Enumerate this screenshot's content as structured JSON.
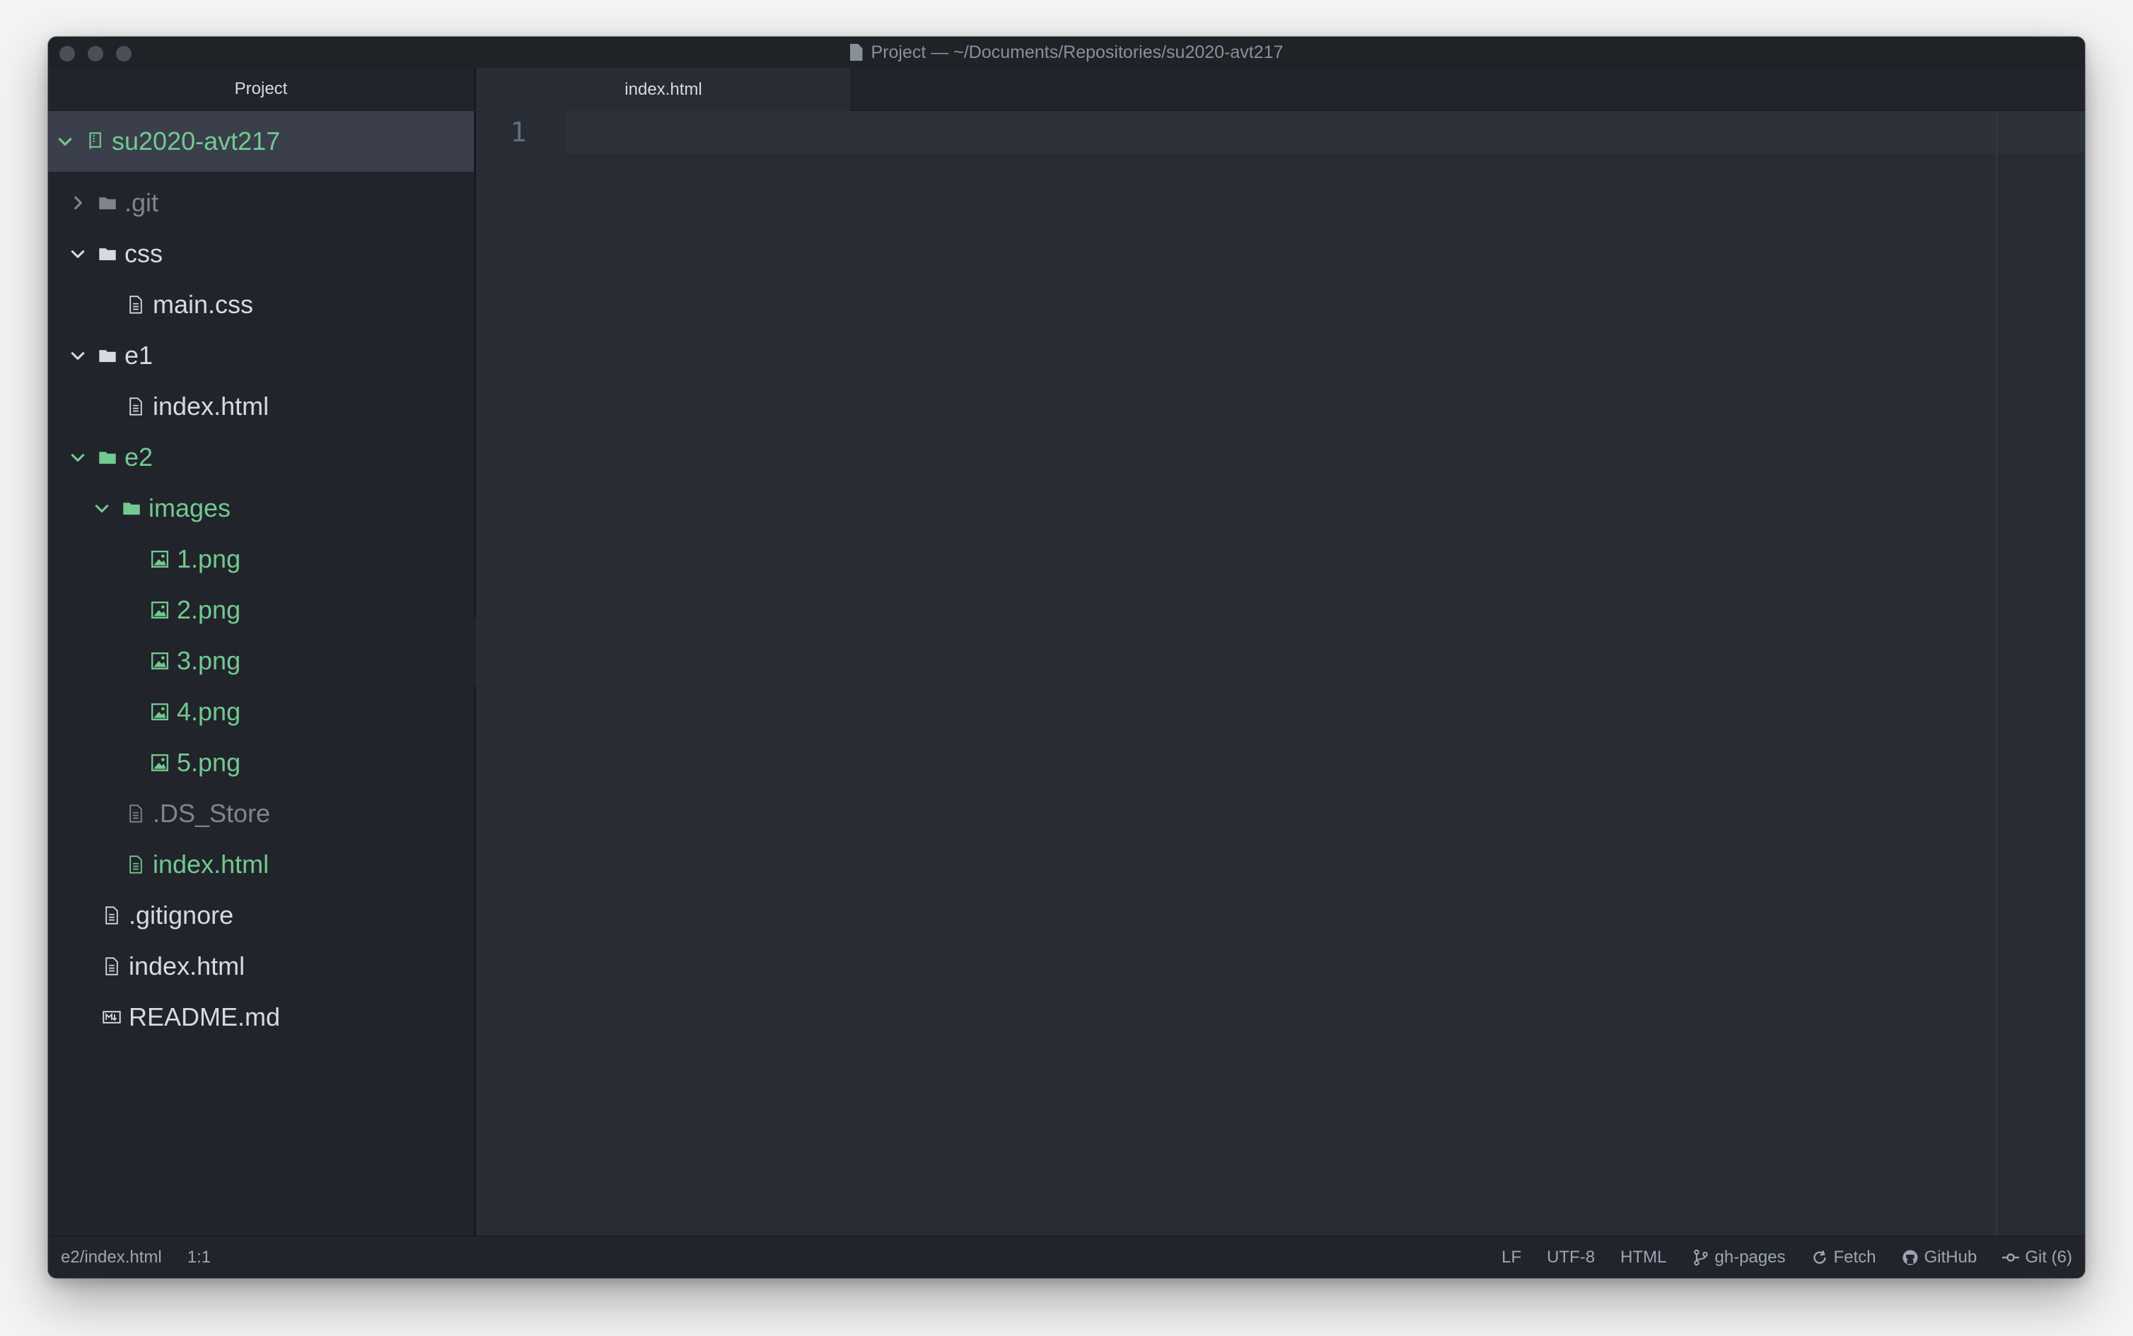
{
  "window": {
    "title": "Project — ~/Documents/Repositories/su2020-avt217"
  },
  "sidebar": {
    "header": "Project",
    "root": "su2020-avt217",
    "items": [
      {
        "label": ".git",
        "kind": "folder",
        "expanded": false,
        "depth": 1,
        "status": "ignored"
      },
      {
        "label": "css",
        "kind": "folder",
        "expanded": true,
        "depth": 1,
        "status": "normal"
      },
      {
        "label": "main.css",
        "kind": "file",
        "depth": 2,
        "status": "normal"
      },
      {
        "label": "e1",
        "kind": "folder",
        "expanded": true,
        "depth": 1,
        "status": "normal"
      },
      {
        "label": "index.html",
        "kind": "file",
        "depth": 2,
        "status": "normal"
      },
      {
        "label": "e2",
        "kind": "folder",
        "expanded": true,
        "depth": 1,
        "status": "added"
      },
      {
        "label": "images",
        "kind": "folder",
        "expanded": true,
        "depth": 2,
        "status": "added"
      },
      {
        "label": "1.png",
        "kind": "image",
        "depth": 3,
        "status": "added"
      },
      {
        "label": "2.png",
        "kind": "image",
        "depth": 3,
        "status": "added"
      },
      {
        "label": "3.png",
        "kind": "image",
        "depth": 3,
        "status": "added"
      },
      {
        "label": "4.png",
        "kind": "image",
        "depth": 3,
        "status": "added"
      },
      {
        "label": "5.png",
        "kind": "image",
        "depth": 3,
        "status": "added"
      },
      {
        "label": ".DS_Store",
        "kind": "file",
        "depth": 2,
        "status": "ignored"
      },
      {
        "label": "index.html",
        "kind": "file",
        "depth": 2,
        "status": "added"
      },
      {
        "label": ".gitignore",
        "kind": "file",
        "depth": 1,
        "status": "normal"
      },
      {
        "label": "index.html",
        "kind": "file",
        "depth": 1,
        "status": "normal"
      },
      {
        "label": "README.md",
        "kind": "markdown",
        "depth": 1,
        "status": "normal"
      }
    ]
  },
  "tabs": [
    {
      "label": "index.html",
      "active": true
    }
  ],
  "editor": {
    "line_number": "1"
  },
  "statusbar": {
    "path": "e2/index.html",
    "cursor": "1:1",
    "line_ending": "LF",
    "encoding": "UTF-8",
    "grammar": "HTML",
    "branch": "gh-pages",
    "fetch": "Fetch",
    "github": "GitHub",
    "git": "Git (6)"
  },
  "colors": {
    "added": "#73c990",
    "ignored": "#7f848e",
    "text": "#d7dae0",
    "background": "#282c34",
    "panel": "#21252b"
  }
}
